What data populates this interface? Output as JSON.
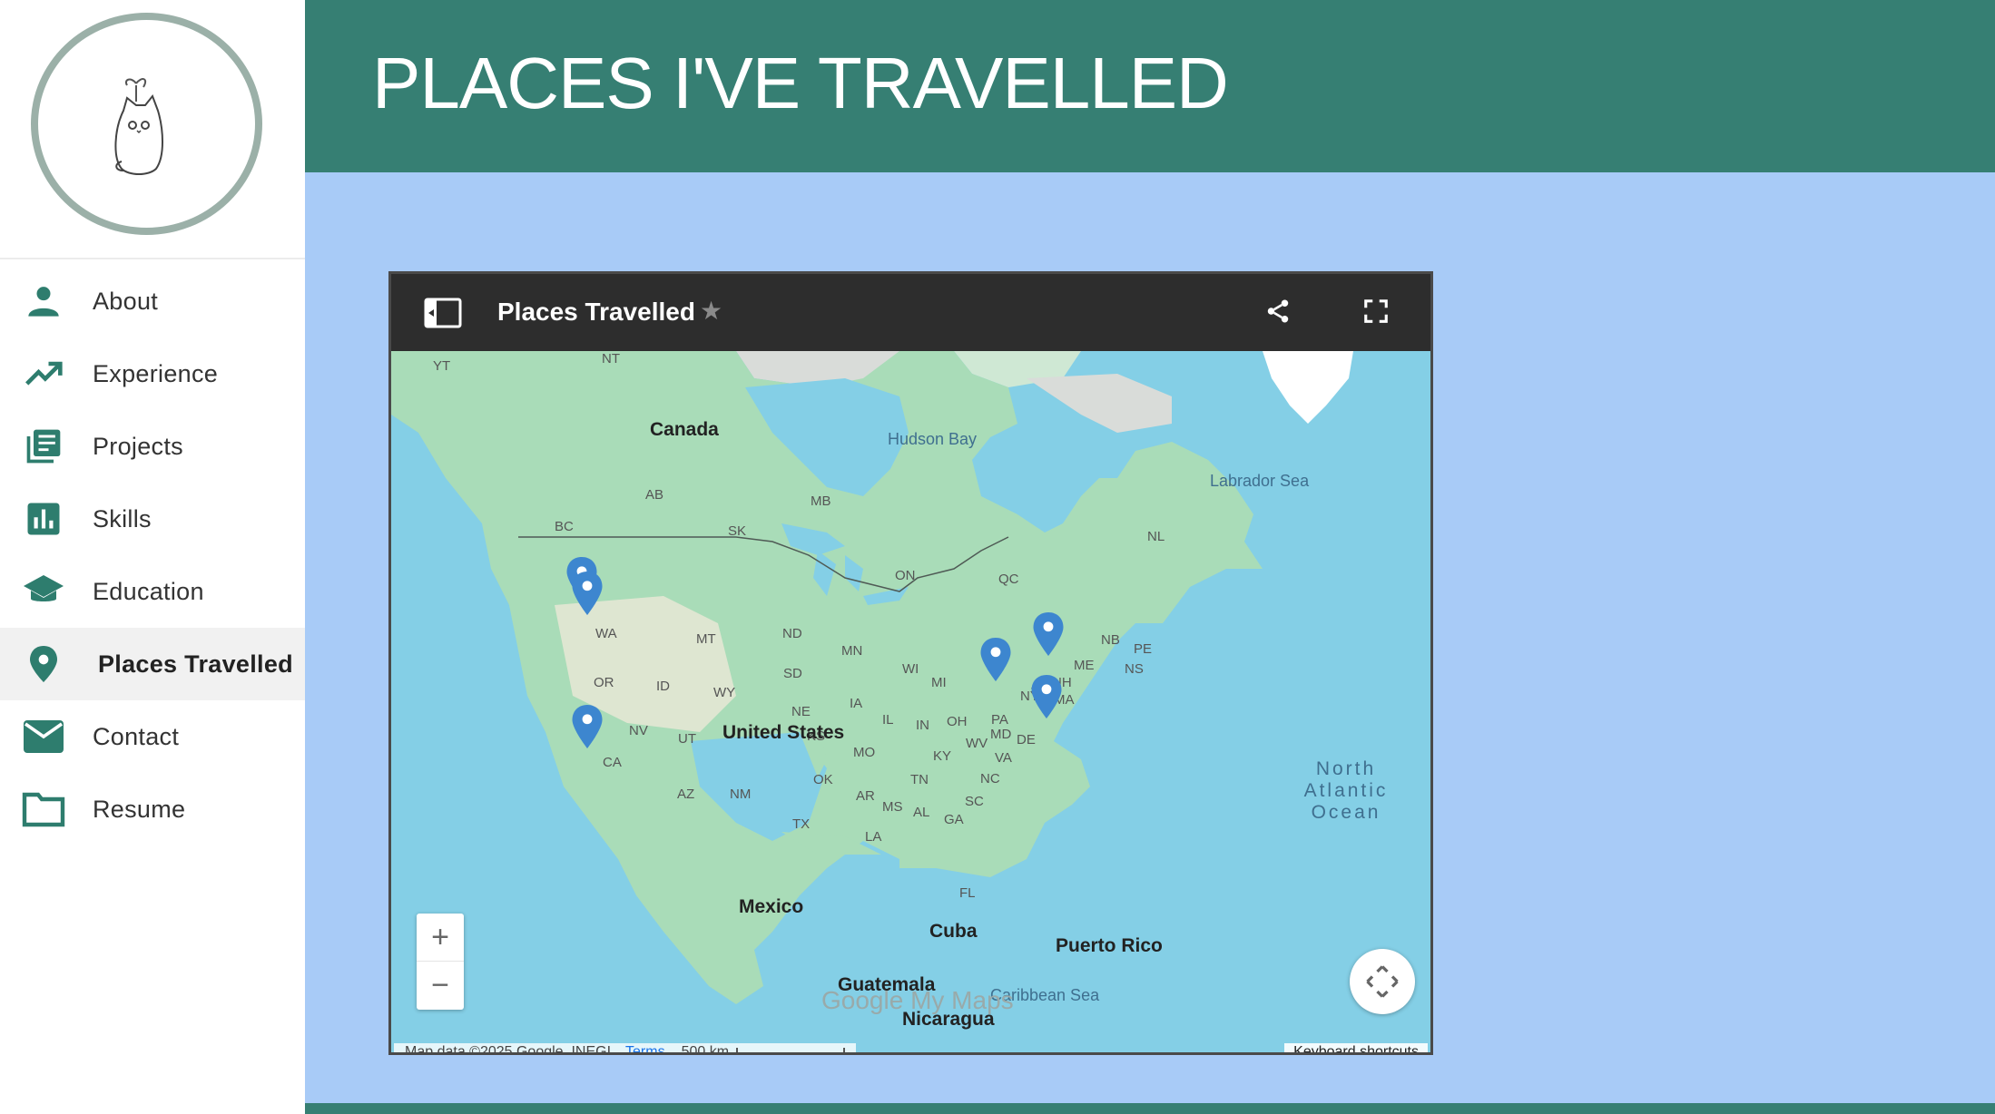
{
  "header": {
    "title": "PLACES I'VE TRAVELLED"
  },
  "sidebar": {
    "logo": "cat-logo-icon",
    "items": [
      {
        "label": "About",
        "icon": "person-icon",
        "active": false
      },
      {
        "label": "Experience",
        "icon": "trending-up-icon",
        "active": false
      },
      {
        "label": "Projects",
        "icon": "projects-icon",
        "active": false
      },
      {
        "label": "Skills",
        "icon": "bar-chart-icon",
        "active": false
      },
      {
        "label": "Education",
        "icon": "graduation-cap-icon",
        "active": false
      },
      {
        "label": "Places Travelled",
        "icon": "location-pin-icon",
        "active": true
      },
      {
        "label": "Contact",
        "icon": "mail-icon",
        "active": false
      },
      {
        "label": "Resume",
        "icon": "folder-icon",
        "active": false
      }
    ]
  },
  "map_embed": {
    "title": "Places Travelled",
    "toolbar_icons": [
      "side-panel-icon",
      "star-icon",
      "share-icon",
      "fullscreen-icon"
    ],
    "labels": {
      "countries": [
        "Canada",
        "United States",
        "Mexico",
        "Cuba",
        "Puerto Rico",
        "Guatemala",
        "Nicaragua"
      ],
      "water": [
        "Hudson Bay",
        "Labrador Sea",
        "Caribbean Sea"
      ],
      "ocean": "North Atlantic Ocean",
      "regions": [
        "YT",
        "NT",
        "BC",
        "AB",
        "SK",
        "MB",
        "ON",
        "QC",
        "NL",
        "NB",
        "PE",
        "NS",
        "WA",
        "OR",
        "CA",
        "NV",
        "ID",
        "MT",
        "WY",
        "UT",
        "AZ",
        "NM",
        "ND",
        "SD",
        "NE",
        "KS",
        "OK",
        "TX",
        "MN",
        "IA",
        "MO",
        "AR",
        "LA",
        "WI",
        "IL",
        "MI",
        "IN",
        "OH",
        "KY",
        "TN",
        "MS",
        "AL",
        "GA",
        "FL",
        "SC",
        "NC",
        "VA",
        "WV",
        "PA",
        "MD",
        "DE",
        "NY",
        "VT",
        "NH",
        "MA",
        "ME"
      ]
    },
    "zoom": {
      "in": "+",
      "out": "−"
    },
    "branding": {
      "logo": "Google My Maps"
    },
    "attribution": {
      "data": "Map data ©2025 Google, INEGI",
      "terms": "Terms",
      "scale": "500 km"
    },
    "keyboard_shortcuts": "Keyboard shortcuts",
    "pins": [
      {
        "place": "Vancouver area"
      },
      {
        "place": "Seattle area"
      },
      {
        "place": "San Francisco Bay Area"
      },
      {
        "place": "Toronto area"
      },
      {
        "place": "Montreal area"
      },
      {
        "place": "New York / Boston area"
      }
    ],
    "colors": {
      "water": "#84cfe6",
      "land": "#a9dcb8",
      "pin": "#3d86cf",
      "bar": "#2d2d2d"
    }
  },
  "colors": {
    "header": "#367f73",
    "background": "#a8cbf7",
    "icon": "#2e7d6e"
  }
}
